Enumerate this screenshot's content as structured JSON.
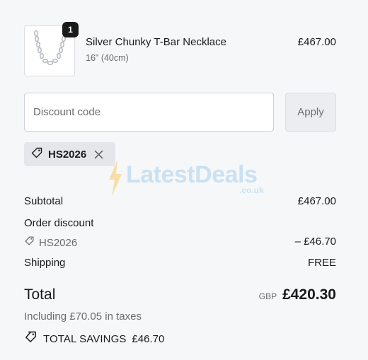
{
  "product": {
    "name": "Silver Chunky T-Bar Necklace",
    "variant": "16\" (40cm)",
    "price": "£467.00",
    "quantity": "1",
    "image_icon": "necklace-image"
  },
  "discount_form": {
    "placeholder": "Discount code",
    "apply_label": "Apply"
  },
  "applied_code": {
    "code": "HS2026",
    "icon": "tag-icon",
    "remove_icon": "close-icon"
  },
  "watermark": {
    "brand": "LatestDeals",
    "suffix": ".co.uk"
  },
  "summary": {
    "subtotal_label": "Subtotal",
    "subtotal_value": "£467.00",
    "order_discount_label": "Order discount",
    "order_discount_code": "HS2026",
    "order_discount_value": "– £46.70",
    "shipping_label": "Shipping",
    "shipping_value": "FREE"
  },
  "total": {
    "label": "Total",
    "currency": "GBP",
    "amount": "£420.30",
    "taxes_note": "Including £70.05 in taxes"
  },
  "savings": {
    "label": "TOTAL SAVINGS",
    "amount": "£46.70"
  },
  "colors": {
    "background": "#f6f7f9",
    "text": "#1a1a1a",
    "muted": "#6b6b6b",
    "chip": "#e4e6ea"
  }
}
